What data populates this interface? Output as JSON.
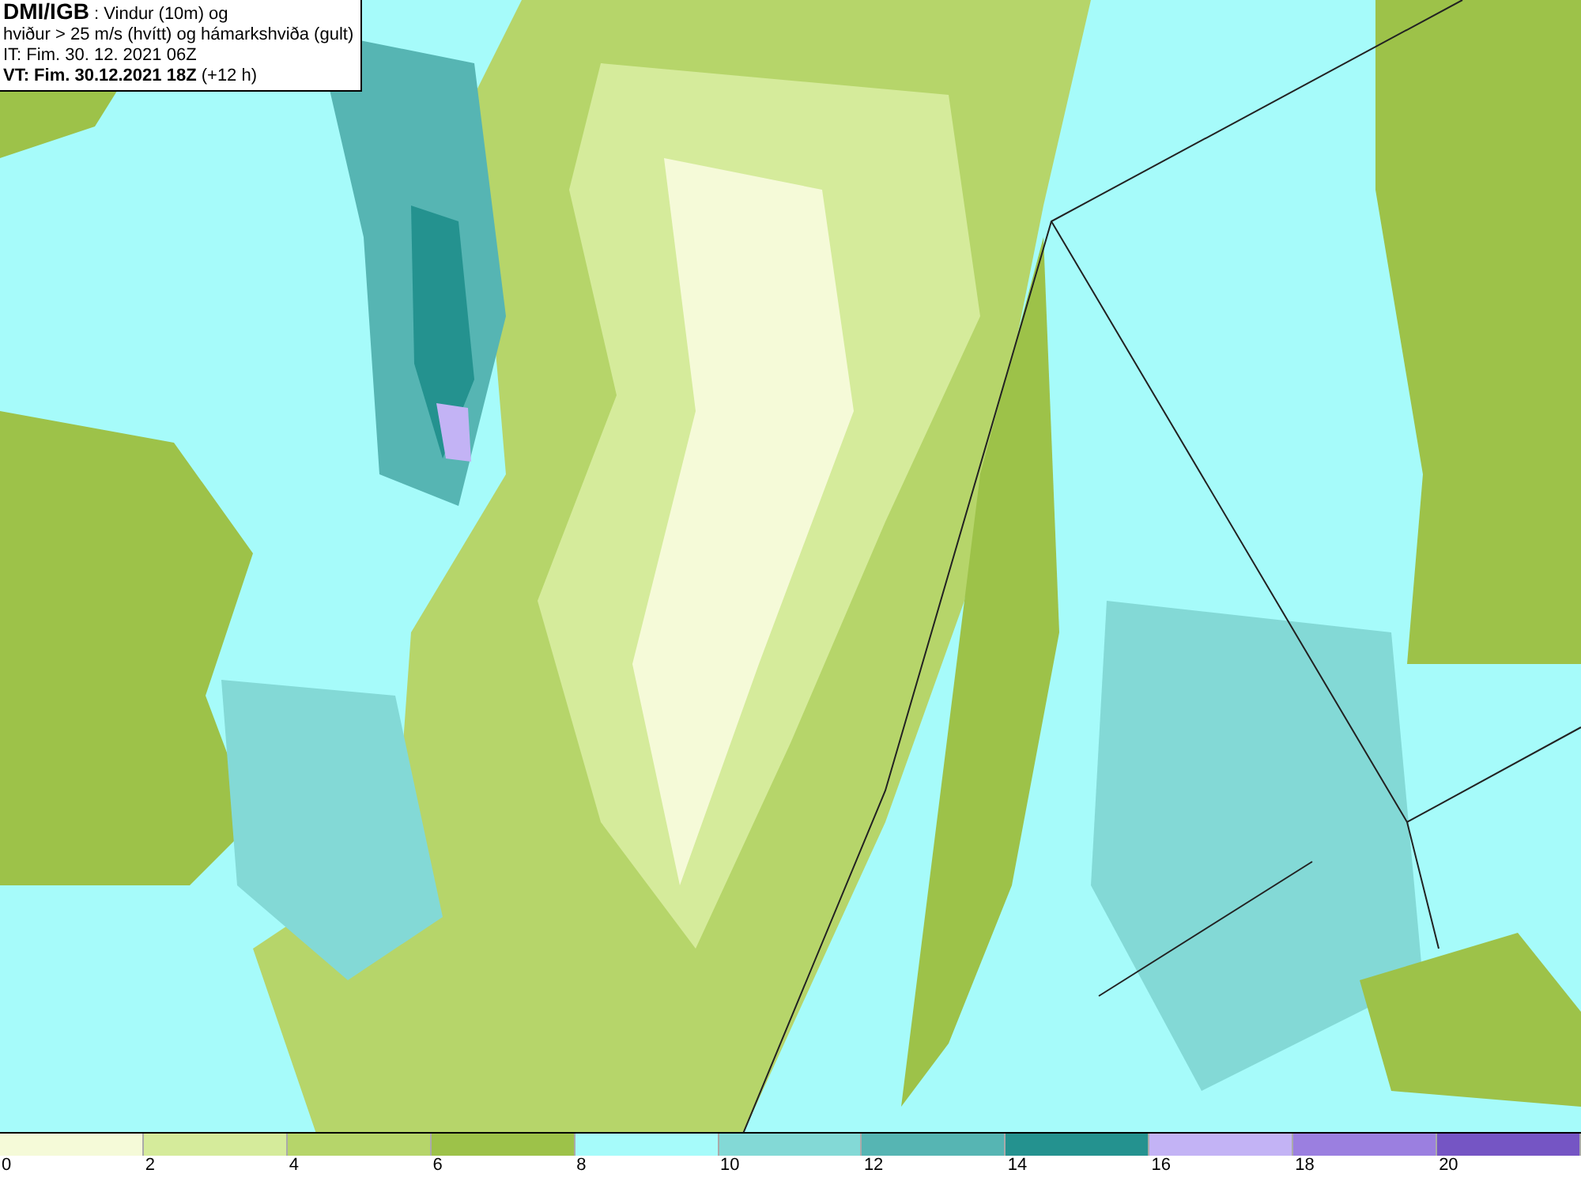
{
  "header": {
    "lines": [
      {
        "text": "**DMI/IGB** : Vindur (10m) og",
        "bold": false
      },
      {
        "text": "hviður > 25 m/s (hvítt) og hámarkshviða (gult)",
        "bold": false
      },
      {
        "text": "IT: Fim. 30. 12. 2021 06Z",
        "bold": false
      },
      {
        "text": "**VT: Fim. 30.12.2021 18Z** (+12 h)",
        "bold": false
      }
    ]
  },
  "legend": {
    "bins": [
      {
        "label": "0",
        "color": "#f5fad8"
      },
      {
        "label": "2",
        "color": "#d5eb9b"
      },
      {
        "label": "4",
        "color": "#b6d56a"
      },
      {
        "label": "6",
        "color": "#9dc249"
      },
      {
        "label": "8",
        "color": "#a6fbfa"
      },
      {
        "label": "10",
        "color": "#83d9d6"
      },
      {
        "label": "12",
        "color": "#56b5b3"
      },
      {
        "label": "14",
        "color": "#24928f"
      },
      {
        "label": "16",
        "color": "#c3b3f5"
      },
      {
        "label": "18",
        "color": "#9b7fe0"
      },
      {
        "label": "20",
        "color": "#7555c4"
      }
    ]
  }
}
